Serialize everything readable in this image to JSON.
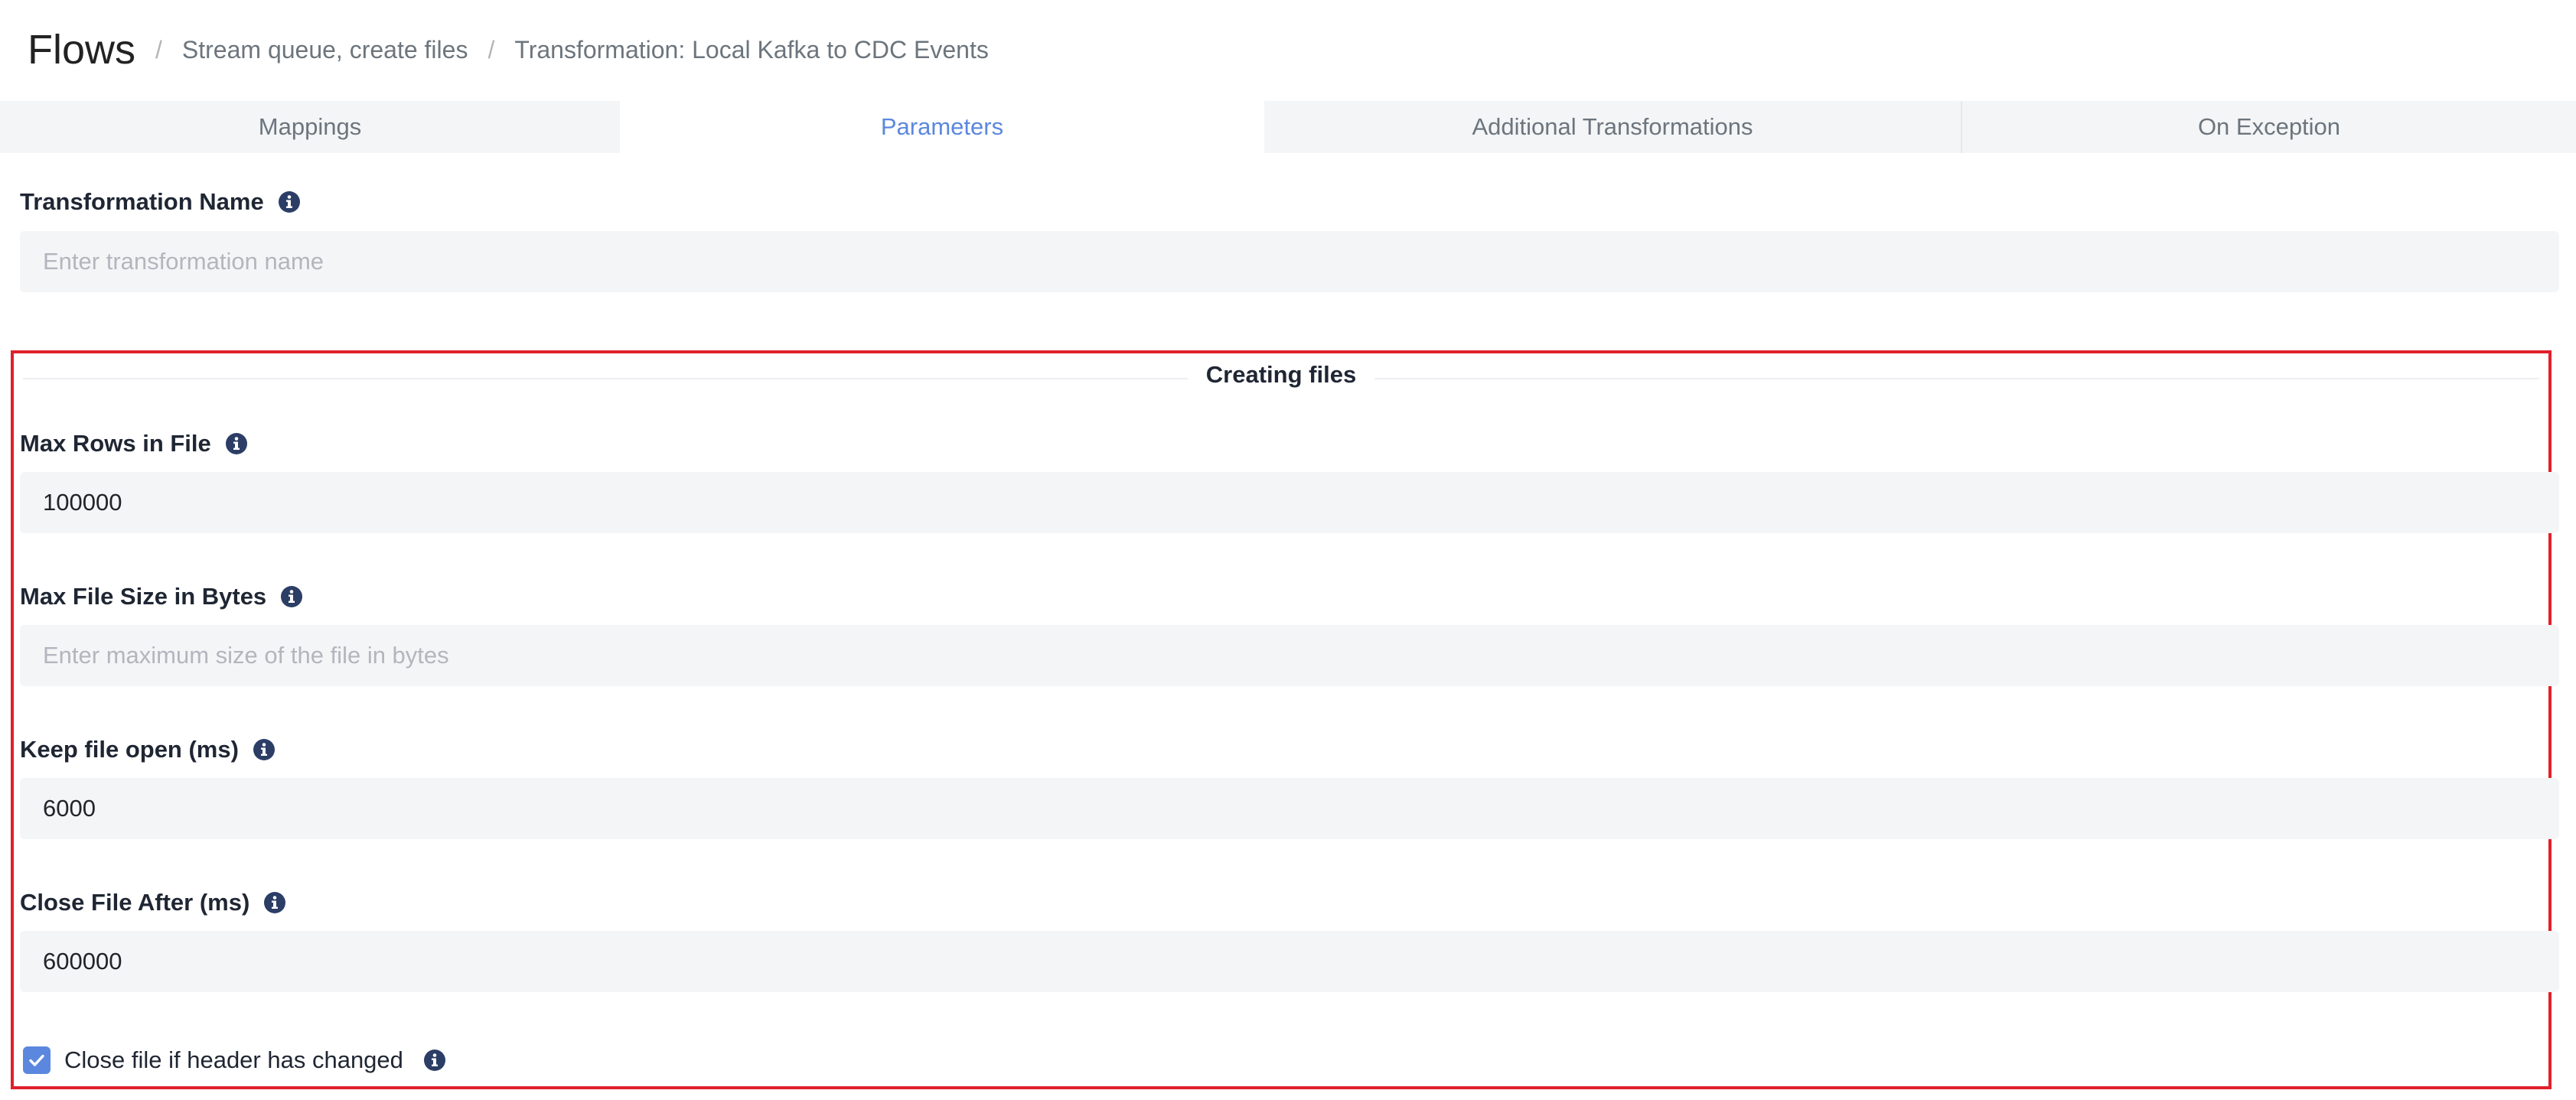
{
  "header": {
    "title": "Flows",
    "breadcrumbs": [
      "Stream queue, create files",
      "Transformation: Local Kafka to CDC Events"
    ]
  },
  "tabs": [
    {
      "label": "Mappings",
      "active": false
    },
    {
      "label": "Parameters",
      "active": true
    },
    {
      "label": "Additional Transformations",
      "active": false
    },
    {
      "label": "On Exception",
      "active": false
    }
  ],
  "transformation_name": {
    "label": "Transformation Name",
    "value": "",
    "placeholder": "Enter transformation name"
  },
  "creating_files": {
    "title": "Creating files",
    "max_rows": {
      "label": "Max Rows in File",
      "value": "100000",
      "placeholder": ""
    },
    "max_file_size": {
      "label": "Max File Size in Bytes",
      "value": "",
      "placeholder": "Enter maximum size of the file in bytes"
    },
    "keep_file_open": {
      "label": "Keep file open (ms)",
      "value": "6000",
      "placeholder": ""
    },
    "close_file_after": {
      "label": "Close File After (ms)",
      "value": "600000",
      "placeholder": ""
    },
    "close_on_header_change": {
      "label": "Close file if header has changed",
      "checked": true
    }
  },
  "colors": {
    "accent": "#5b87de",
    "info_icon": "#2c3e66",
    "highlight_border": "#e0202b"
  },
  "icons": {
    "info": "info-circle-icon",
    "check": "check-icon"
  }
}
